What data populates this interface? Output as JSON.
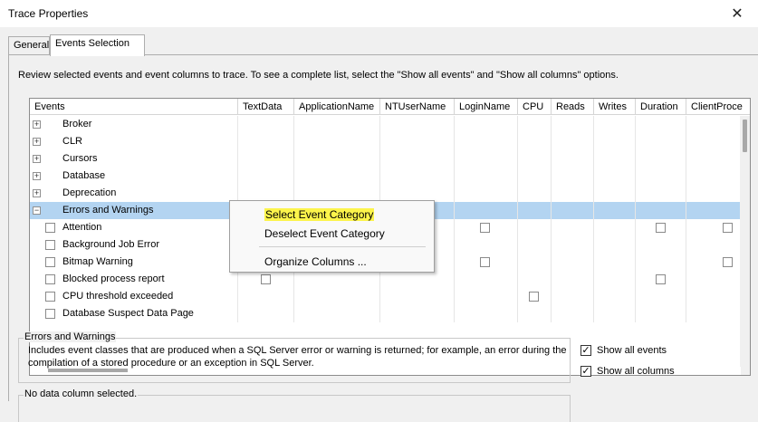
{
  "window": {
    "title": "Trace Properties",
    "close_glyph": "✕"
  },
  "tabs": [
    {
      "label": "General",
      "active": false
    },
    {
      "label": "Events Selection",
      "active": true
    }
  ],
  "description": "Review selected events and event columns to trace. To see a complete list, select the \"Show all events\" and \"Show all columns\" options.",
  "grid": {
    "columns": [
      "Events",
      "TextData",
      "ApplicationName",
      "NTUserName",
      "LoginName",
      "CPU",
      "Reads",
      "Writes",
      "Duration",
      "ClientProce"
    ],
    "rows": [
      {
        "label": "Broker",
        "type": "category",
        "expander": "+"
      },
      {
        "label": "CLR",
        "type": "category",
        "expander": "+"
      },
      {
        "label": "Cursors",
        "type": "category",
        "expander": "+"
      },
      {
        "label": "Database",
        "type": "category",
        "expander": "+"
      },
      {
        "label": "Deprecation",
        "type": "category",
        "expander": "+"
      },
      {
        "label": "Errors and Warnings",
        "type": "category",
        "expander": "−",
        "selected": true
      },
      {
        "label": "Attention",
        "type": "event"
      },
      {
        "label": "Background Job Error",
        "type": "event"
      },
      {
        "label": "Bitmap Warning",
        "type": "event"
      },
      {
        "label": "Blocked process report",
        "type": "event"
      },
      {
        "label": "CPU threshold exceeded",
        "type": "event"
      },
      {
        "label": "Database Suspect Data Page",
        "type": "event"
      }
    ]
  },
  "context_menu": {
    "items": [
      {
        "label": "Select Event Category",
        "highlighted": true
      },
      {
        "label": "Deselect Event Category",
        "highlighted": false
      },
      {
        "label": "Organize Columns ...",
        "highlighted": false
      }
    ]
  },
  "event_group": {
    "title": "Errors and Warnings",
    "text": "Includes event classes that are produced when a SQL Server error or warning is returned; for example, an error during the compilation of a stored procedure or an exception in SQL Server."
  },
  "column_group": {
    "title": "No data column selected."
  },
  "options": {
    "show_all_events": {
      "label": "Show all events",
      "checked": true
    },
    "show_all_columns": {
      "label": "Show all columns",
      "checked": true
    }
  },
  "highlight_color": "#fcf44b",
  "selection_color": "#b3d4f1"
}
